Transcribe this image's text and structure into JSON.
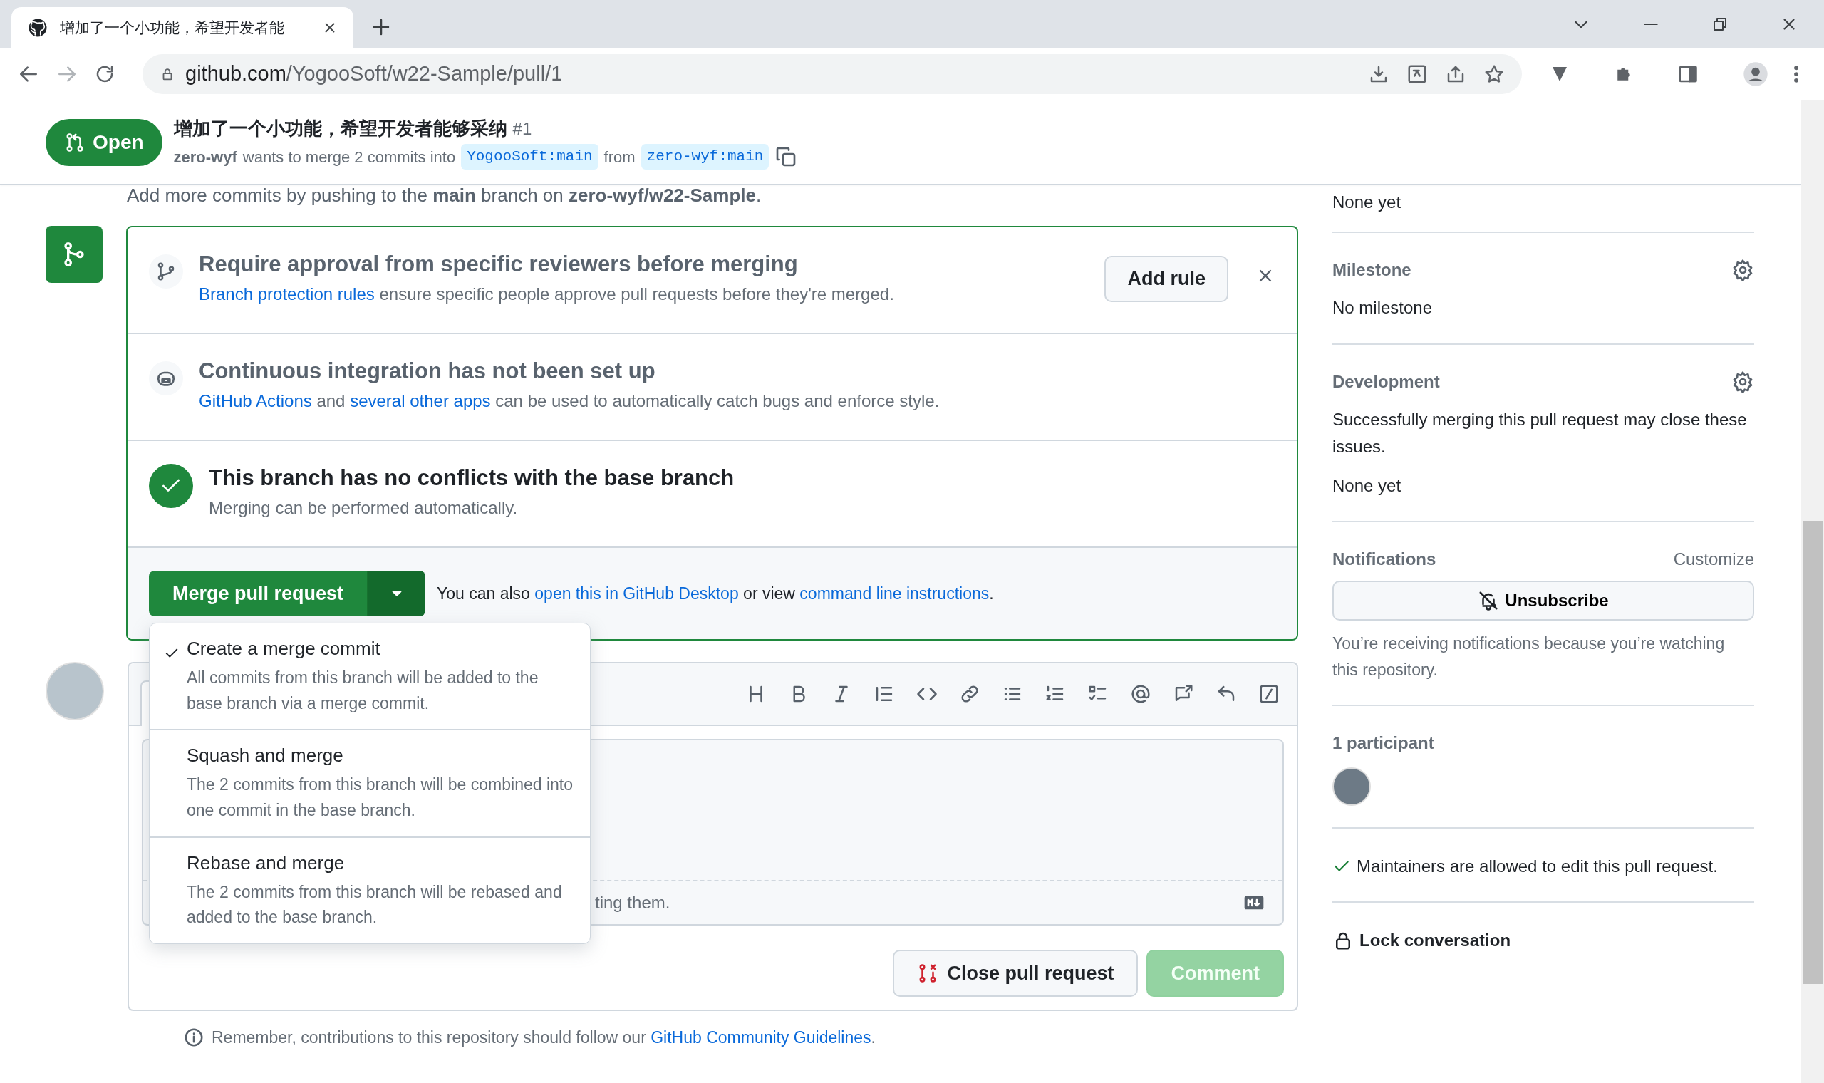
{
  "browser": {
    "tab_title": "增加了一个小功能，希望开发者能",
    "url_host": "github.com",
    "url_path": "/YogooSoft/w22-Sample/pull/1"
  },
  "pr_header": {
    "state": "Open",
    "title": "增加了一个小功能，希望开发者能够采纳",
    "number": "#1",
    "author": "zero-wyf",
    "summary": "wants to merge 2 commits into",
    "base_branch": "YogooSoft:main",
    "from_label": "from",
    "head_branch": "zero-wyf:main"
  },
  "push_hint": "Add more commits by pushing to the **main** branch on **zero-wyf/w22-Sample**.",
  "merge_box": {
    "sections": [
      {
        "kind": "branch",
        "title": "Require approval from specific reviewers before merging",
        "description": [
          {
            "text": "Branch protection rules",
            "link": true
          },
          {
            "text": " ensure specific people approve pull requests before they're merged.",
            "link": false
          }
        ],
        "action": "Add rule",
        "dismissible": true
      },
      {
        "kind": "robot",
        "title": "Continuous integration has not been set up",
        "description": [
          {
            "text": "GitHub Actions",
            "link": true
          },
          {
            "text": " and ",
            "link": false
          },
          {
            "text": "several other apps",
            "link": true
          },
          {
            "text": " can be used to automatically catch bugs and enforce style.",
            "link": false
          }
        ]
      },
      {
        "kind": "check",
        "title": "This branch has no conflicts with the base branch",
        "description": [
          {
            "text": "Merging can be performed automatically.",
            "link": false
          }
        ]
      }
    ],
    "merge_button": "Merge pull request",
    "menu_expanded": true,
    "footer_text": [
      {
        "text": "You can also ",
        "link": false
      },
      {
        "text": "open this in GitHub Desktop",
        "link": true
      },
      {
        "text": " or view ",
        "link": false
      },
      {
        "text": "command line instructions",
        "link": true
      },
      {
        "text": ".",
        "link": false
      }
    ],
    "merge_options": [
      {
        "title": "Create a merge commit",
        "description": "All commits from this branch will be added to the base branch via a merge commit.",
        "selected": true
      },
      {
        "title": "Squash and merge",
        "description": "The 2 commits from this branch will be combined into one commit in the base branch.",
        "selected": false
      },
      {
        "title": "Rebase and merge",
        "description": "The 2 commits from this branch will be rebased and added to the base branch.",
        "selected": false
      }
    ]
  },
  "comment_box": {
    "footer_hint": "ting them.",
    "buttons": [
      {
        "label": "Close pull request",
        "kind": "close",
        "disabled": false
      },
      {
        "label": "Comment",
        "kind": "submit",
        "disabled": true
      }
    ]
  },
  "guidelines": [
    {
      "text": "Remember, contributions to this repository should follow our ",
      "link": false
    },
    {
      "text": "GitHub Community Guidelines",
      "link": true
    },
    {
      "text": ".",
      "link": false
    }
  ],
  "sidebar": {
    "top_value": "None yet",
    "sections": [
      {
        "kind": "plain",
        "heading": "Milestone",
        "settings": true,
        "texts": [
          "No milestone"
        ]
      },
      {
        "kind": "plain",
        "heading": "Development",
        "settings": true,
        "texts": [
          "Successfully merging this pull request may close these issues.",
          "None yet"
        ]
      },
      {
        "kind": "notifications",
        "heading": "Notifications",
        "action": "Customize",
        "button": "Unsubscribe",
        "note": "You’re receiving notifications because you’re watching this repository."
      },
      {
        "kind": "participants",
        "heading": "1 participant"
      },
      {
        "kind": "check",
        "text": "Maintainers are allowed to edit this pull request."
      },
      {
        "kind": "lock",
        "text": "Lock conversation"
      }
    ]
  }
}
